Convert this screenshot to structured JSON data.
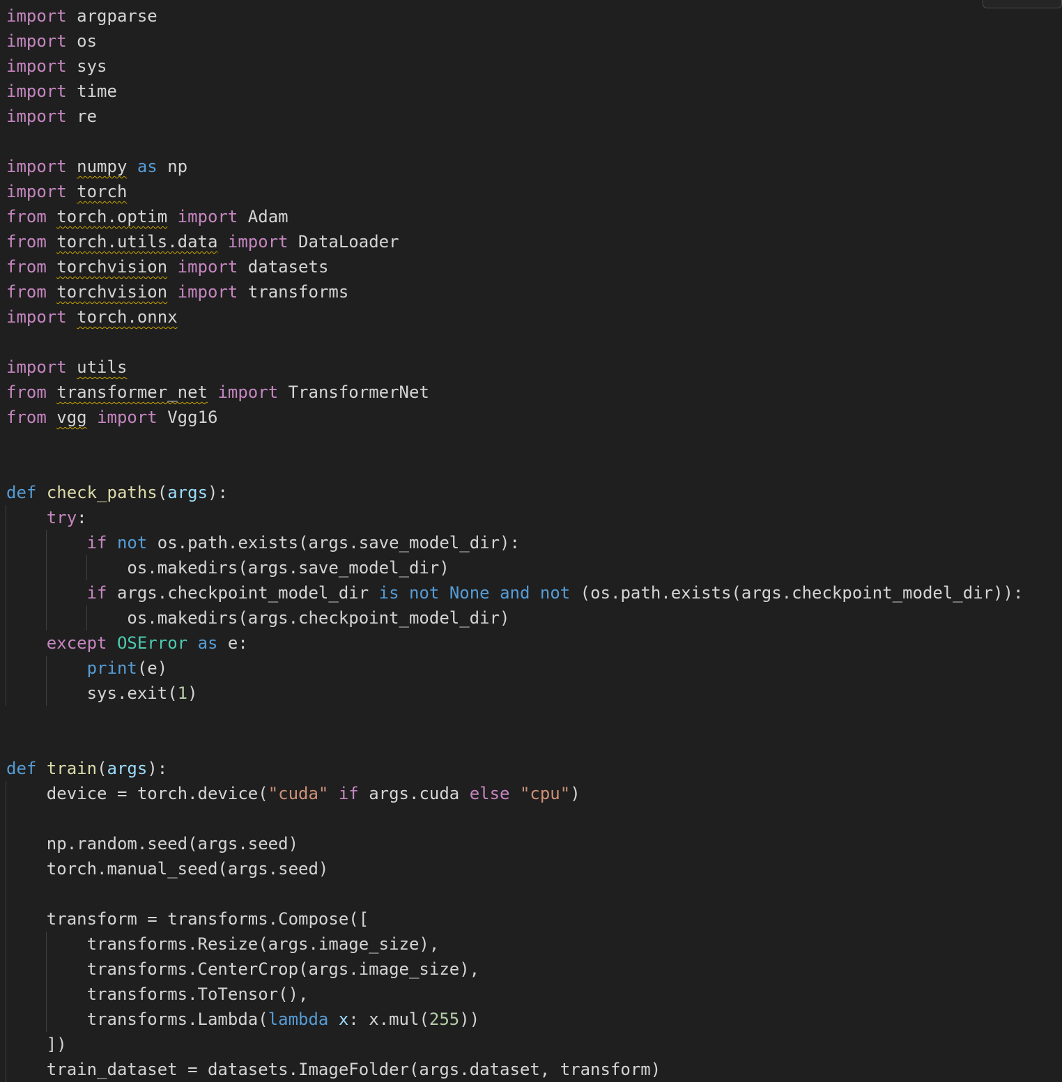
{
  "colors": {
    "background": "#1f1f1f",
    "default": "#d4d4d4",
    "import_keyword": "#c586c0",
    "storage_keyword": "#569cd6",
    "function_name": "#dcdcaa",
    "parameter": "#9cdcfe",
    "builtin_type": "#4ec9b0",
    "string": "#ce9178",
    "number": "#b5cea8",
    "squiggle": "#cca700"
  },
  "lines": [
    {
      "indent": 0,
      "tokens": [
        {
          "t": "import",
          "c": "import_keyword"
        },
        {
          "t": " argparse"
        }
      ]
    },
    {
      "indent": 0,
      "tokens": [
        {
          "t": "import",
          "c": "import_keyword"
        },
        {
          "t": " os"
        }
      ]
    },
    {
      "indent": 0,
      "tokens": [
        {
          "t": "import",
          "c": "import_keyword"
        },
        {
          "t": " sys"
        }
      ]
    },
    {
      "indent": 0,
      "tokens": [
        {
          "t": "import",
          "c": "import_keyword"
        },
        {
          "t": " time"
        }
      ]
    },
    {
      "indent": 0,
      "tokens": [
        {
          "t": "import",
          "c": "import_keyword"
        },
        {
          "t": " re"
        }
      ]
    },
    {
      "indent": 0,
      "tokens": []
    },
    {
      "indent": 0,
      "tokens": [
        {
          "t": "import",
          "c": "import_keyword"
        },
        {
          "t": " "
        },
        {
          "t": "numpy",
          "w": true
        },
        {
          "t": " "
        },
        {
          "t": "as",
          "c": "storage_keyword"
        },
        {
          "t": " np"
        }
      ]
    },
    {
      "indent": 0,
      "tokens": [
        {
          "t": "import",
          "c": "import_keyword"
        },
        {
          "t": " "
        },
        {
          "t": "torch",
          "w": true
        }
      ]
    },
    {
      "indent": 0,
      "tokens": [
        {
          "t": "from",
          "c": "import_keyword"
        },
        {
          "t": " "
        },
        {
          "t": "torch.optim",
          "w": true
        },
        {
          "t": " "
        },
        {
          "t": "import",
          "c": "import_keyword"
        },
        {
          "t": " Adam"
        }
      ]
    },
    {
      "indent": 0,
      "tokens": [
        {
          "t": "from",
          "c": "import_keyword"
        },
        {
          "t": " "
        },
        {
          "t": "torch.utils.data",
          "w": true
        },
        {
          "t": " "
        },
        {
          "t": "import",
          "c": "import_keyword"
        },
        {
          "t": " DataLoader"
        }
      ]
    },
    {
      "indent": 0,
      "tokens": [
        {
          "t": "from",
          "c": "import_keyword"
        },
        {
          "t": " "
        },
        {
          "t": "torchvision",
          "w": true
        },
        {
          "t": " "
        },
        {
          "t": "import",
          "c": "import_keyword"
        },
        {
          "t": " datasets"
        }
      ]
    },
    {
      "indent": 0,
      "tokens": [
        {
          "t": "from",
          "c": "import_keyword"
        },
        {
          "t": " "
        },
        {
          "t": "torchvision",
          "w": true
        },
        {
          "t": " "
        },
        {
          "t": "import",
          "c": "import_keyword"
        },
        {
          "t": " transforms"
        }
      ]
    },
    {
      "indent": 0,
      "tokens": [
        {
          "t": "import",
          "c": "import_keyword"
        },
        {
          "t": " "
        },
        {
          "t": "torch.onnx",
          "w": true
        }
      ]
    },
    {
      "indent": 0,
      "tokens": []
    },
    {
      "indent": 0,
      "tokens": [
        {
          "t": "import",
          "c": "import_keyword"
        },
        {
          "t": " "
        },
        {
          "t": "utils",
          "w": true
        }
      ]
    },
    {
      "indent": 0,
      "tokens": [
        {
          "t": "from",
          "c": "import_keyword"
        },
        {
          "t": " "
        },
        {
          "t": "transformer_net",
          "w": true
        },
        {
          "t": " "
        },
        {
          "t": "import",
          "c": "import_keyword"
        },
        {
          "t": " TransformerNet"
        }
      ]
    },
    {
      "indent": 0,
      "tokens": [
        {
          "t": "from",
          "c": "import_keyword"
        },
        {
          "t": " "
        },
        {
          "t": "vgg",
          "w": true
        },
        {
          "t": " "
        },
        {
          "t": "import",
          "c": "import_keyword"
        },
        {
          "t": " Vgg16"
        }
      ]
    },
    {
      "indent": 0,
      "tokens": []
    },
    {
      "indent": 0,
      "tokens": []
    },
    {
      "indent": 0,
      "tokens": [
        {
          "t": "def",
          "c": "storage_keyword"
        },
        {
          "t": " "
        },
        {
          "t": "check_paths",
          "c": "function_name"
        },
        {
          "t": "("
        },
        {
          "t": "args",
          "c": "parameter"
        },
        {
          "t": "):"
        }
      ]
    },
    {
      "indent": 1,
      "tokens": [
        {
          "t": "try",
          "c": "import_keyword"
        },
        {
          "t": ":"
        }
      ]
    },
    {
      "indent": 2,
      "tokens": [
        {
          "t": "if",
          "c": "import_keyword"
        },
        {
          "t": " "
        },
        {
          "t": "not",
          "c": "storage_keyword"
        },
        {
          "t": " os.path.exists(args.save_model_dir):"
        }
      ]
    },
    {
      "indent": 3,
      "tokens": [
        {
          "t": "os.makedirs(args.save_model_dir)"
        }
      ]
    },
    {
      "indent": 2,
      "tokens": [
        {
          "t": "if",
          "c": "import_keyword"
        },
        {
          "t": " args.checkpoint_model_dir "
        },
        {
          "t": "is",
          "c": "storage_keyword"
        },
        {
          "t": " "
        },
        {
          "t": "not",
          "c": "storage_keyword"
        },
        {
          "t": " "
        },
        {
          "t": "None",
          "c": "storage_keyword"
        },
        {
          "t": " "
        },
        {
          "t": "and",
          "c": "storage_keyword"
        },
        {
          "t": " "
        },
        {
          "t": "not",
          "c": "storage_keyword"
        },
        {
          "t": " (os.path.exists(args.checkpoint_model_dir)):"
        }
      ]
    },
    {
      "indent": 3,
      "tokens": [
        {
          "t": "os.makedirs(args.checkpoint_model_dir)"
        }
      ]
    },
    {
      "indent": 1,
      "tokens": [
        {
          "t": "except",
          "c": "import_keyword"
        },
        {
          "t": " "
        },
        {
          "t": "OSError",
          "c": "builtin_type"
        },
        {
          "t": " "
        },
        {
          "t": "as",
          "c": "storage_keyword"
        },
        {
          "t": " e:"
        }
      ]
    },
    {
      "indent": 2,
      "tokens": [
        {
          "t": "print",
          "c": "storage_keyword"
        },
        {
          "t": "(e)"
        }
      ]
    },
    {
      "indent": 2,
      "tokens": [
        {
          "t": "sys.exit("
        },
        {
          "t": "1",
          "c": "number"
        },
        {
          "t": ")"
        }
      ]
    },
    {
      "indent": 0,
      "tokens": []
    },
    {
      "indent": 0,
      "tokens": []
    },
    {
      "indent": 0,
      "tokens": [
        {
          "t": "def",
          "c": "storage_keyword"
        },
        {
          "t": " "
        },
        {
          "t": "train",
          "c": "function_name"
        },
        {
          "t": "("
        },
        {
          "t": "args",
          "c": "parameter"
        },
        {
          "t": "):"
        }
      ]
    },
    {
      "indent": 1,
      "tokens": [
        {
          "t": "device = torch.device("
        },
        {
          "t": "\"cuda\"",
          "c": "string"
        },
        {
          "t": " "
        },
        {
          "t": "if",
          "c": "import_keyword"
        },
        {
          "t": " args.cuda "
        },
        {
          "t": "else",
          "c": "import_keyword"
        },
        {
          "t": " "
        },
        {
          "t": "\"cpu\"",
          "c": "string"
        },
        {
          "t": ")"
        }
      ]
    },
    {
      "indent": 0,
      "tokens": []
    },
    {
      "indent": 1,
      "tokens": [
        {
          "t": "np.random.seed(args.seed)"
        }
      ]
    },
    {
      "indent": 1,
      "tokens": [
        {
          "t": "torch.manual_seed(args.seed)"
        }
      ]
    },
    {
      "indent": 0,
      "tokens": []
    },
    {
      "indent": 1,
      "tokens": [
        {
          "t": "transform = transforms.Compose(["
        }
      ]
    },
    {
      "indent": 2,
      "tokens": [
        {
          "t": "transforms.Resize(args.image_size),"
        }
      ]
    },
    {
      "indent": 2,
      "tokens": [
        {
          "t": "transforms.CenterCrop(args.image_size),"
        }
      ]
    },
    {
      "indent": 2,
      "tokens": [
        {
          "t": "transforms.ToTensor(),"
        }
      ]
    },
    {
      "indent": 2,
      "tokens": [
        {
          "t": "transforms.Lambda("
        },
        {
          "t": "lambda",
          "c": "storage_keyword"
        },
        {
          "t": " "
        },
        {
          "t": "x",
          "c": "parameter"
        },
        {
          "t": ": x.mul("
        },
        {
          "t": "255",
          "c": "number"
        },
        {
          "t": "))"
        }
      ]
    },
    {
      "indent": 1,
      "tokens": [
        {
          "t": "])"
        }
      ]
    },
    {
      "indent": 1,
      "tokens": [
        {
          "t": "train_dataset = datasets.ImageFolder(args.dataset, transform)"
        }
      ]
    }
  ]
}
